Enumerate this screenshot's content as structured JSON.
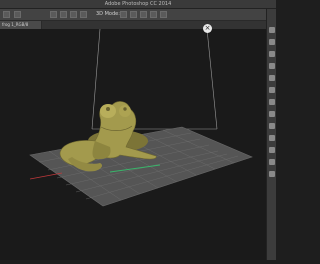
{
  "window": {
    "title": "Adobe Photoshop CC 2014"
  },
  "options_bar": {
    "mode_label": "3D Mode:"
  },
  "document": {
    "tab_label": "frog 1_RGB/8"
  },
  "viewport": {
    "close_glyph": "×"
  },
  "icons": {
    "toolbar": [
      "move-tool-icon",
      "rotate-3d-icon",
      "roll-3d-icon",
      "drag-3d-icon",
      "slide-3d-icon",
      "scale-3d-icon"
    ],
    "right_panel": [
      "color-icon",
      "swatches-icon",
      "layers-icon",
      "channels-icon",
      "paths-icon",
      "properties-icon",
      "3d-panel-icon",
      "history-icon",
      "adjustments-icon",
      "styles-icon",
      "brush-icon",
      "character-icon",
      "paragraph-icon"
    ]
  },
  "colors": {
    "frog": "#a39a4d",
    "ground_plane": "#555555",
    "axis_x": "#c0393b",
    "axis_z": "#39b56a",
    "bounding_box": "#9a9a9a"
  }
}
